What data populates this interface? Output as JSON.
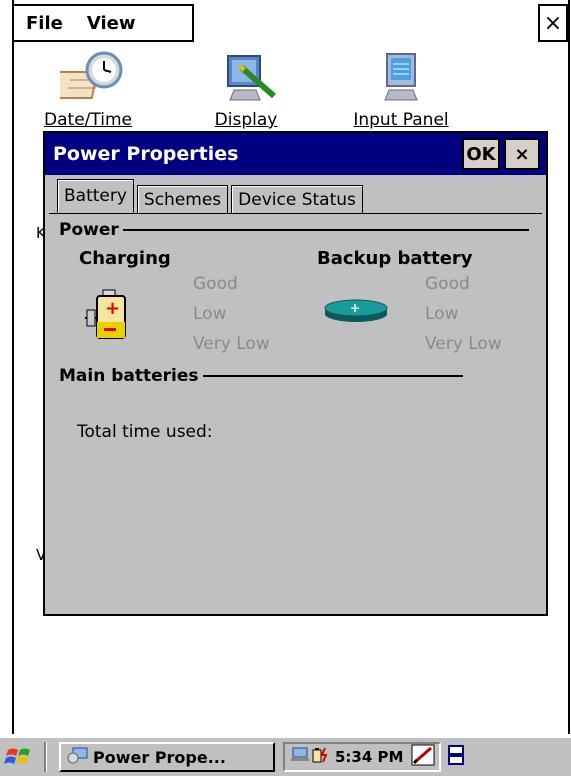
{
  "menu": {
    "file_label": "File",
    "view_label": "View",
    "close_label": "×"
  },
  "desktop": {
    "icons": [
      {
        "label": "Date/Time",
        "icon": "date-time-icon"
      },
      {
        "label": "Display",
        "icon": "display-icon"
      },
      {
        "label": "Input Panel",
        "icon": "input-panel-icon"
      }
    ]
  },
  "dialog": {
    "title": "Power Properties",
    "ok_label": "OK",
    "close_label": "×",
    "tabs": [
      {
        "label": "Battery"
      },
      {
        "label": "Schemes"
      },
      {
        "label": "Device Status"
      }
    ],
    "power": {
      "heading": "Power",
      "charging": {
        "heading": "Charging",
        "icon": "charging-battery-icon",
        "levels": [
          "Good",
          "Low",
          "Very Low"
        ]
      },
      "backup": {
        "heading": "Backup battery",
        "icon": "backup-battery-icon",
        "levels": [
          "Good",
          "Low",
          "Very Low"
        ]
      }
    },
    "main_batteries": {
      "heading": "Main batteries",
      "total_time_label": "Total time used:"
    }
  },
  "taskbar": {
    "start_icon": "windows-flag-icon",
    "task_label": "Power Prope...",
    "time": "5:34 PM"
  },
  "colors": {
    "titlebar": "#000080",
    "dialog_bg": "#c0c0c0",
    "disabled_text": "#8a8a8a"
  }
}
